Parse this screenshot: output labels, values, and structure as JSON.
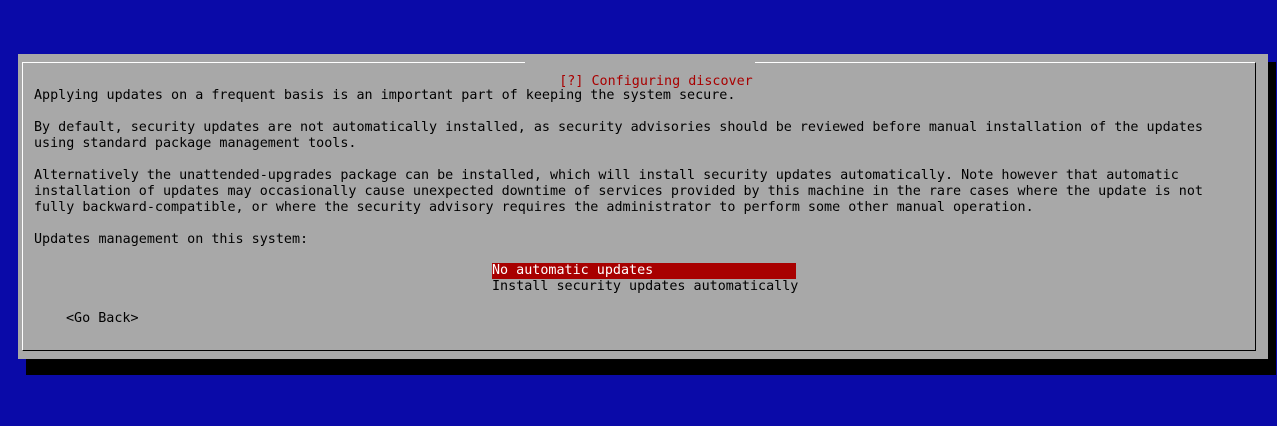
{
  "dialog": {
    "title": "[?] Configuring discover",
    "paragraphs": [
      "Applying updates on a frequent basis is an important part of keeping the system secure.",
      "By default, security updates are not automatically installed, as security advisories should be reviewed before manual installation of the updates\nusing standard package management tools.",
      "Alternatively the unattended-upgrades package can be installed, which will install security updates automatically. Note however that automatic\ninstallation of updates may occasionally cause unexpected downtime of services provided by this machine in the rare cases where the update is not\nfully backward-compatible, or where the security advisory requires the administrator to perform some other manual operation."
    ],
    "prompt": "Updates management on this system:",
    "options": [
      "No automatic updates",
      "Install security updates automatically"
    ],
    "selected_option": "No automatic updates",
    "go_back_label": "<Go Back>"
  },
  "colors": {
    "background": "#0a0aa8",
    "dialog": "#a8a8a8",
    "accent": "#a80000"
  }
}
